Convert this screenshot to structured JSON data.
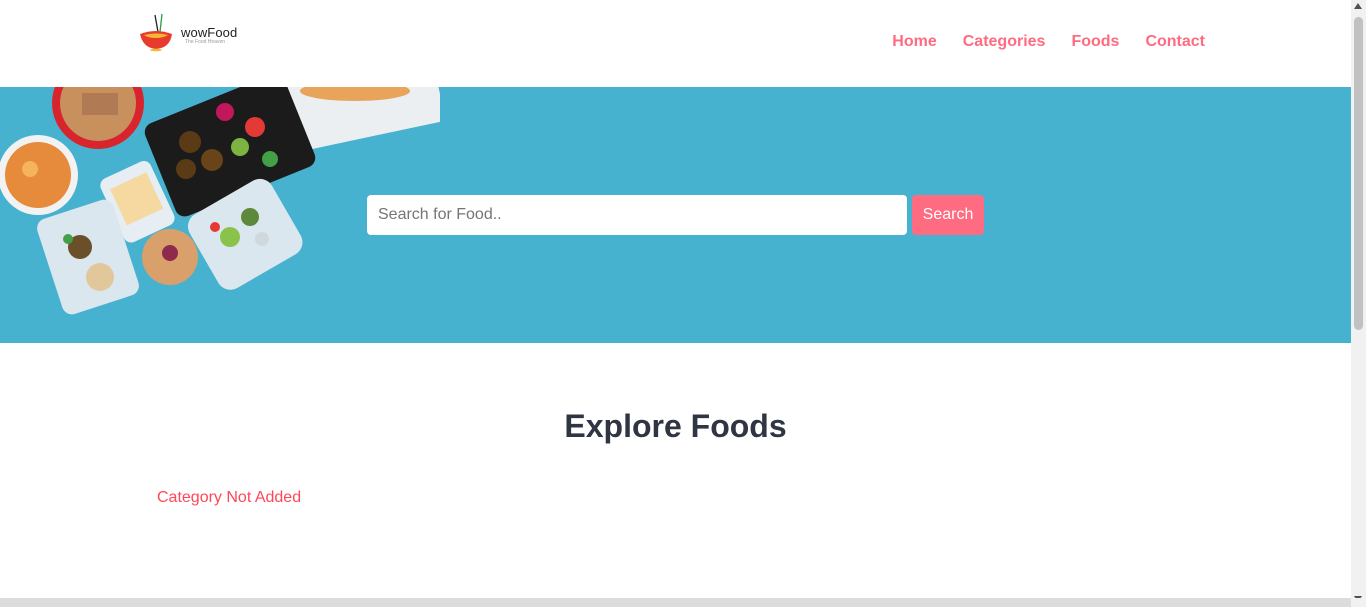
{
  "brand": {
    "name": "wowFood",
    "tagline": "The Food Heaven"
  },
  "nav": {
    "items": [
      {
        "label": "Home"
      },
      {
        "label": "Categories"
      },
      {
        "label": "Foods"
      },
      {
        "label": "Contact"
      }
    ]
  },
  "search": {
    "placeholder": "Search for Food..",
    "value": "",
    "button_label": "Search"
  },
  "explore": {
    "title": "Explore Foods",
    "message": "Category Not Added"
  },
  "colors": {
    "accent": "#ff6b81",
    "hero_bg": "#47b2d0",
    "heading": "#2f3542",
    "error": "#ff4757"
  }
}
